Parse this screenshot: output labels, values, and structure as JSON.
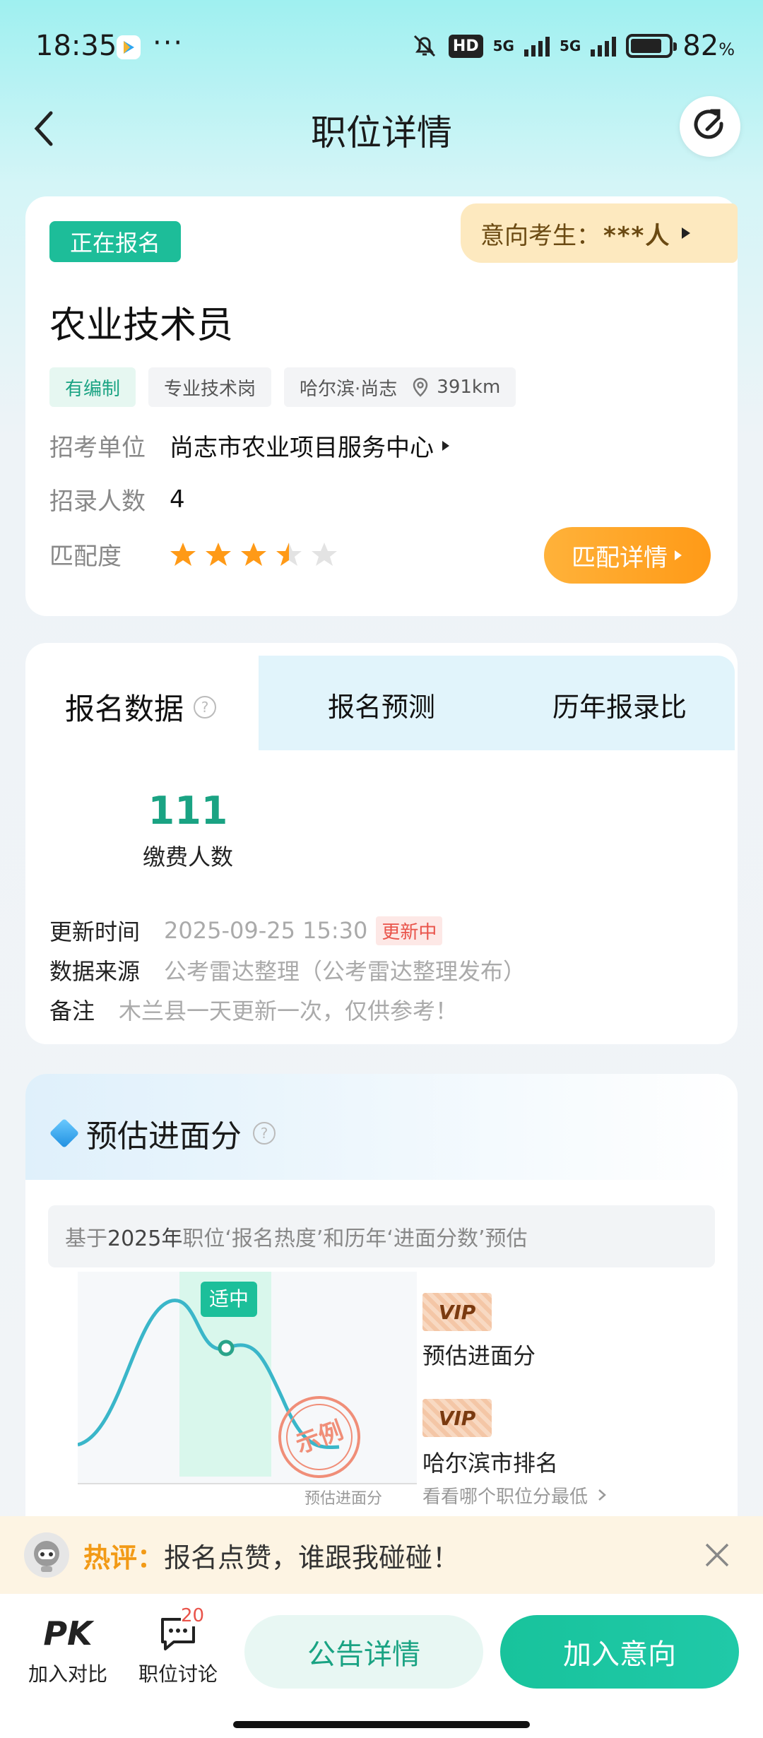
{
  "status": {
    "time": "18:35",
    "battery": "82",
    "battery_unit": "%",
    "network": "5G",
    "hd": "HD"
  },
  "nav": {
    "title": "职位详情"
  },
  "job": {
    "status_badge": "正在报名",
    "intent_label": "意向考生：",
    "intent_value": "***人",
    "name": "农业技术员",
    "tags": [
      "有编制",
      "专业技术岗",
      "哈尔滨·尚志",
      "391km"
    ],
    "employer_label": "招考单位",
    "employer": "尚志市农业项目服务中心",
    "count_label": "招录人数",
    "count": "4",
    "match_label": "匹配度",
    "match_stars": 3.5,
    "match_button": "匹配详情"
  },
  "signup": {
    "tabs": [
      "报名数据",
      "报名预测",
      "历年报录比"
    ],
    "paid_count": "111",
    "paid_label": "缴费人数",
    "update_label": "更新时间",
    "update_time": "2025-09-25 15:30",
    "update_status": "更新中",
    "source_label": "数据来源",
    "source": "公考雷达整理（公考雷达整理发布）",
    "note_label": "备注",
    "note": "木兰县一天更新一次，仅供参考！"
  },
  "estimate": {
    "title": "预估进面分",
    "basis_prefix": "基于",
    "basis_year": "2025年",
    "basis_text": "职位‘报名热度’和历年‘进面分数’预估",
    "chart_marker": "适中",
    "chart_axis": "预估进面分",
    "stamp": "示例",
    "vip": "VIP",
    "item1": "预估进面分",
    "item2": "哈尔滨市排名",
    "item2_link": "看看哪个职位分最低"
  },
  "hot": {
    "label": "热评：",
    "text": "报名点赞，谁跟我碰碰！"
  },
  "bottom": {
    "compare": "加入对比",
    "compare_icon": "PK",
    "discuss": "职位讨论",
    "discuss_badge": "20",
    "notice": "公告详情",
    "join": "加入意向"
  },
  "colors": {
    "accent": "#1aa383",
    "orange": "#ff9a17"
  }
}
